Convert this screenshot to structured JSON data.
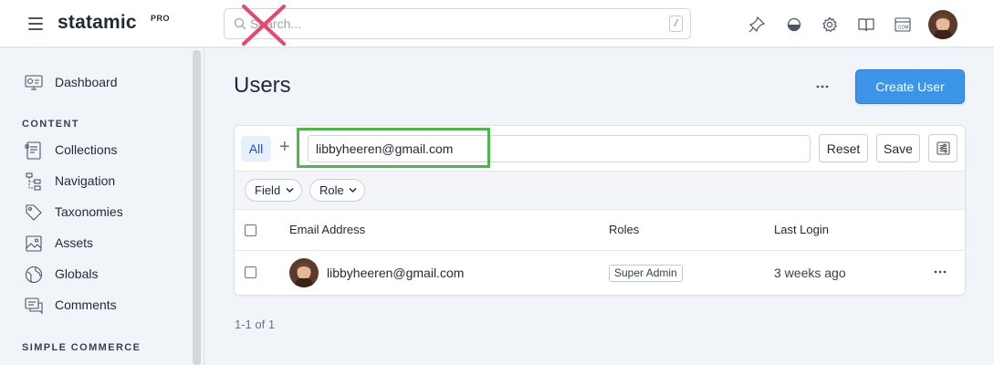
{
  "brand": {
    "name": "statamic",
    "tier": "PRO"
  },
  "search": {
    "placeholder": "Search...",
    "shortcut": "/"
  },
  "topbar_icons": [
    "pin-icon",
    "contrast-icon",
    "gear-icon",
    "book-icon",
    "site-icon"
  ],
  "sidebar": {
    "items": [
      {
        "label": "Dashboard",
        "icon": "dashboard-icon"
      }
    ],
    "sections": [
      {
        "title": "CONTENT",
        "items": [
          {
            "label": "Collections",
            "icon": "collections-icon"
          },
          {
            "label": "Navigation",
            "icon": "navigation-icon"
          },
          {
            "label": "Taxonomies",
            "icon": "tag-icon"
          },
          {
            "label": "Assets",
            "icon": "assets-icon"
          },
          {
            "label": "Globals",
            "icon": "globe-icon"
          },
          {
            "label": "Comments",
            "icon": "comments-icon"
          }
        ]
      },
      {
        "title": "SIMPLE COMMERCE",
        "items": []
      }
    ]
  },
  "page": {
    "title": "Users",
    "create_button": "Create User"
  },
  "filters": {
    "tab_all": "All",
    "add_label": "+",
    "search_value": "libbyheeren@gmail.com",
    "reset_label": "Reset",
    "save_label": "Save",
    "pills": [
      "Field",
      "Role"
    ]
  },
  "table": {
    "columns": [
      "Email Address",
      "Roles",
      "Last Login"
    ],
    "rows": [
      {
        "email": "libbyheeren@gmail.com",
        "role": "Super Admin",
        "last_login": "3 weeks ago"
      }
    ]
  },
  "pagination": {
    "text": "1-1 of 1"
  },
  "colors": {
    "accent": "#3c95e8",
    "highlight": "#4cb84a",
    "annotation_x": "#e8496a"
  }
}
